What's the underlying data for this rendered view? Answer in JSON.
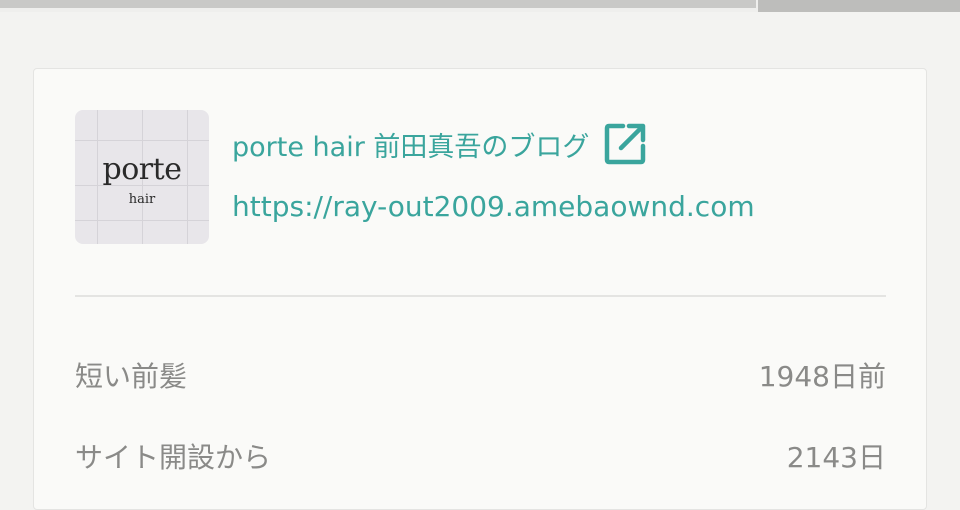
{
  "site": {
    "thumbnail": {
      "logo_main": "porte",
      "logo_sub": "hair"
    },
    "title": "porte hair 前田真吾のブログ",
    "url": "https://ray-out2009.amebaownd.com",
    "external_icon": "external-link-icon",
    "accent_color": "#3aa59d"
  },
  "stats": [
    {
      "label": "短い前髪",
      "value": "1948日前"
    },
    {
      "label": "サイト開設から",
      "value": "2143日"
    }
  ]
}
